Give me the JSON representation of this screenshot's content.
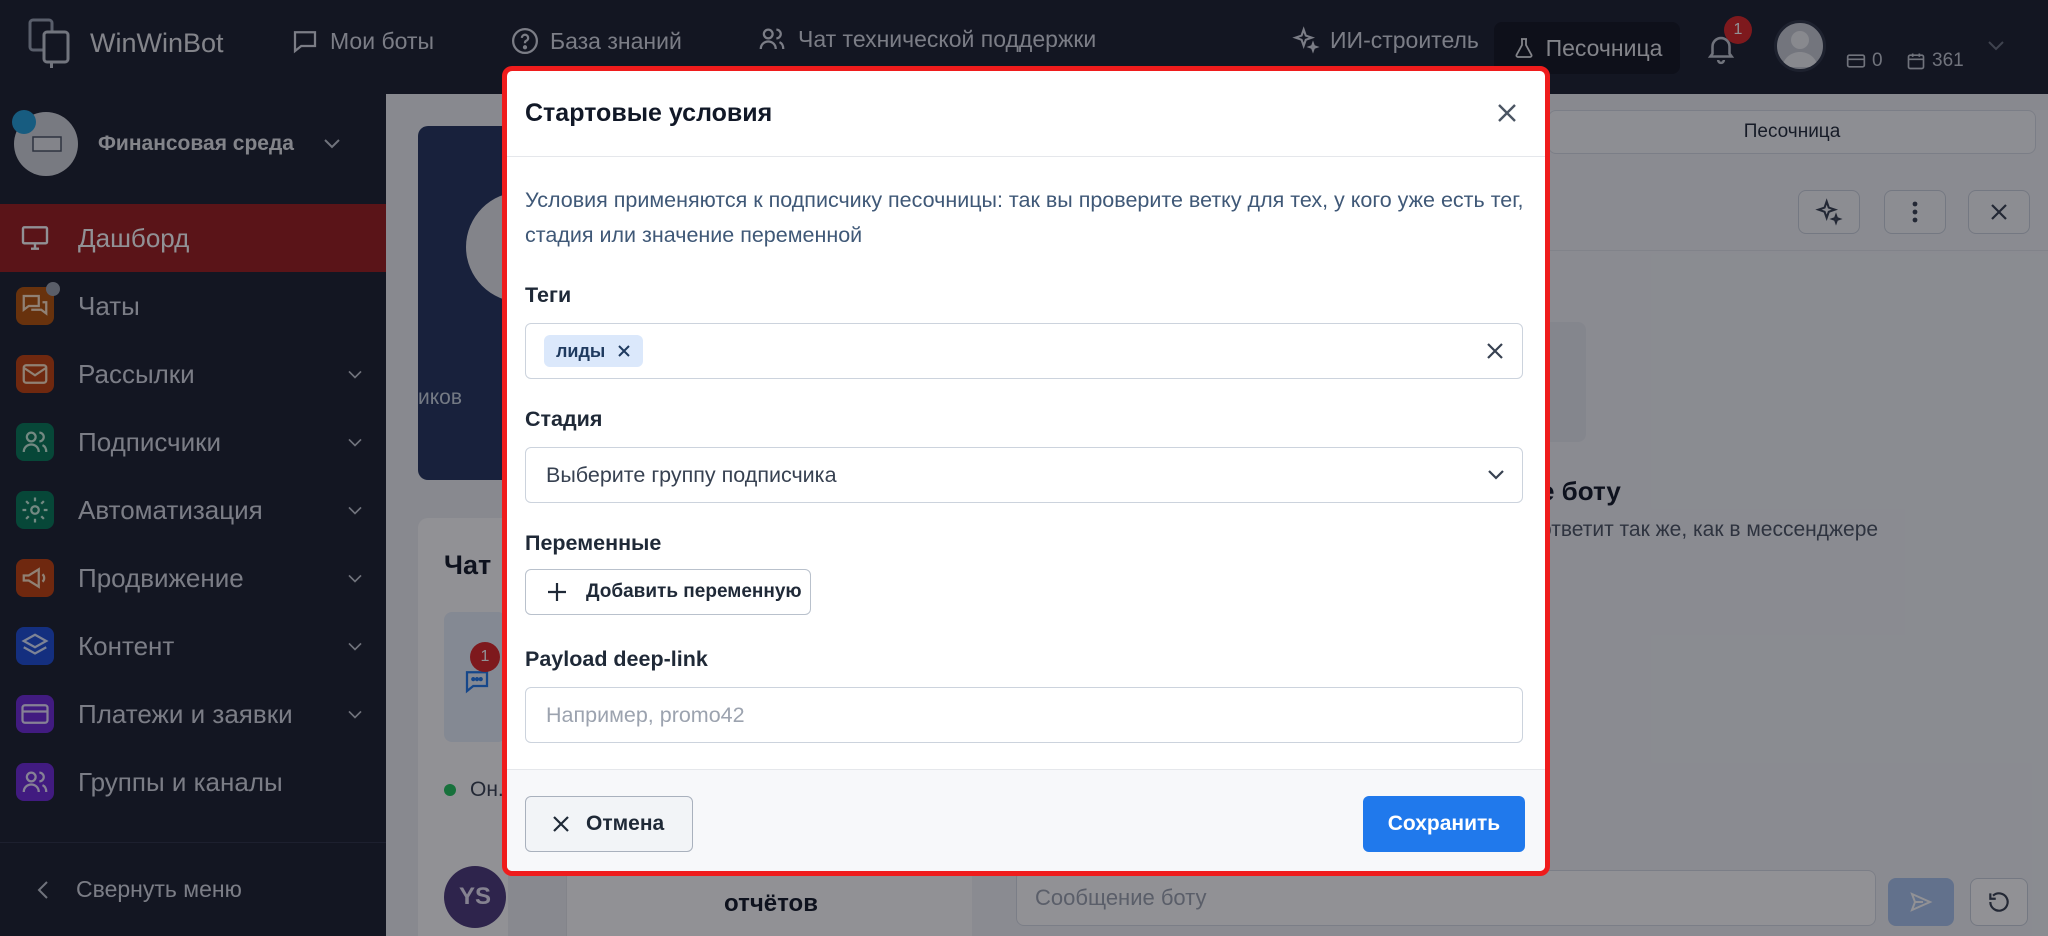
{
  "app": {
    "logo_text": "WinWinBot"
  },
  "topnav": {
    "items": [
      {
        "label": "Мои боты",
        "icon": "chat-bubble-icon"
      },
      {
        "label": "База знаний",
        "icon": "help-circle-icon"
      },
      {
        "label": "Чат технической поддержки",
        "icon": "users-icon"
      },
      {
        "label": "ИИ-строитель",
        "icon": "sparkles-icon"
      }
    ],
    "sandbox_label": "Песочница",
    "notifications_count": "1",
    "stat_a": "0",
    "stat_b": "361"
  },
  "sidebar": {
    "workspace_name": "Финансовая среда",
    "items": [
      {
        "label": "Дашборд",
        "active": true,
        "color": "#9b1c1c"
      },
      {
        "label": "Чаты",
        "color": "#b45309"
      },
      {
        "label": "Рассылки",
        "color": "#c2410c"
      },
      {
        "label": "Подписчики",
        "color": "#047857"
      },
      {
        "label": "Автоматизация",
        "color": "#047857"
      },
      {
        "label": "Продвижение",
        "color": "#c2410c"
      },
      {
        "label": "Контент",
        "color": "#1d4ed8"
      },
      {
        "label": "Платежи и заявки",
        "color": "#6d28d9"
      },
      {
        "label": "Группы и каналы",
        "color": "#6d28d9"
      }
    ],
    "collapse_label": "Свернуть меню"
  },
  "background": {
    "panel_fragment": "иков",
    "chat_title": "Чат",
    "tile_badge": "1",
    "online_label": "Он.",
    "user_initials": "YS",
    "reports_fragment": "отчётов",
    "sandbox_tab": "Песочница",
    "bot_title_fragment": "е боту",
    "bot_sub_fragment": "ответит так же, как в мессенджере",
    "message_placeholder": "Сообщение боту"
  },
  "modal": {
    "title": "Стартовые условия",
    "description": "Условия применяются к подписчику песочницы: так вы проверите ветку для тех, у кого уже есть тег, стадия или значение переменной",
    "tags_label": "Теги",
    "tags": [
      "лиды"
    ],
    "stage_label": "Стадия",
    "stage_placeholder": "Выберите группу подписчика",
    "variables_label": "Переменные",
    "add_variable_label": "Добавить переменную",
    "payload_label": "Payload deep-link",
    "payload_placeholder": "Например, promo42",
    "cancel_label": "Отмена",
    "save_label": "Сохранить"
  },
  "colors": {
    "accent": "#2079ec",
    "highlight_border": "#ef1c1c",
    "sidebar_bg": "#1b1f2e"
  }
}
